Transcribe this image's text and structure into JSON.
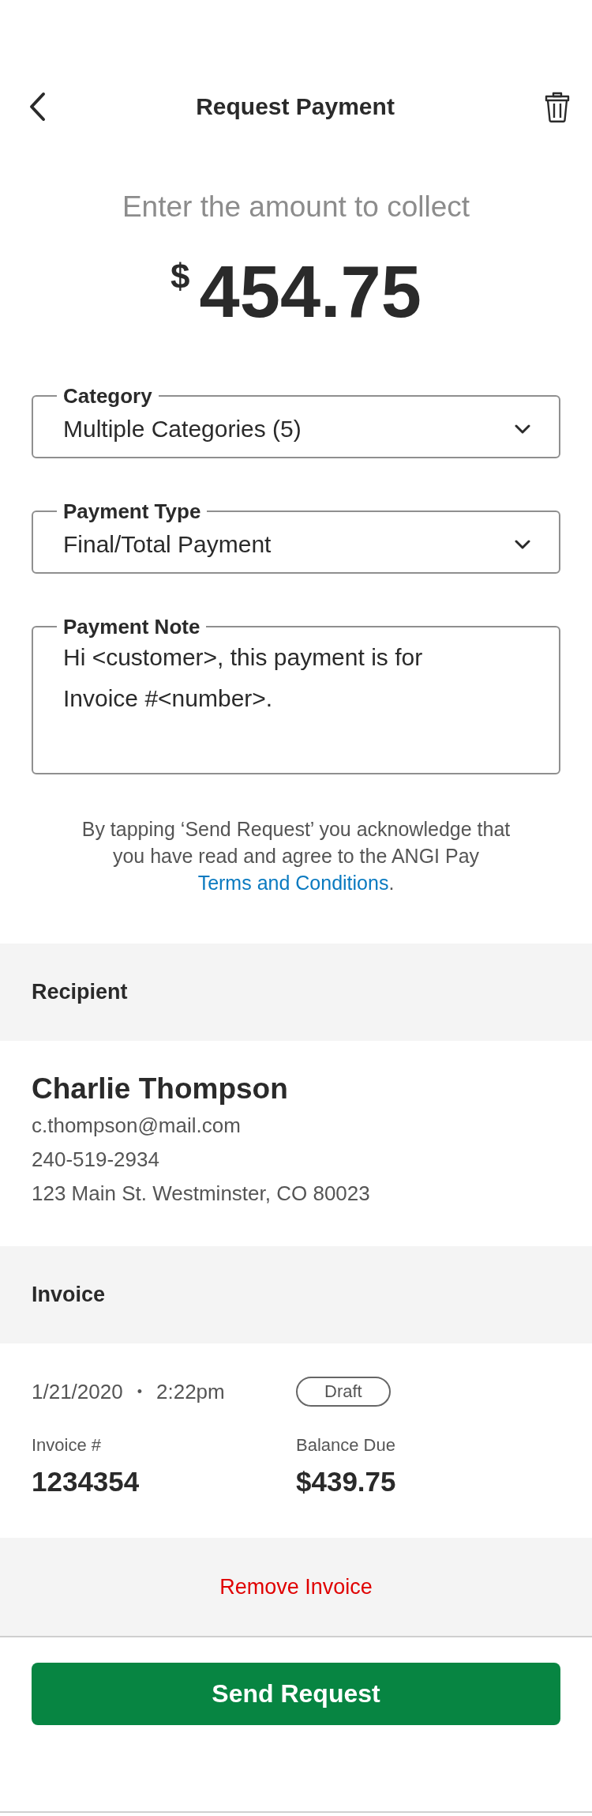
{
  "header": {
    "title": "Request Payment"
  },
  "amount": {
    "prompt": "Enter the amount to collect",
    "currency": "$",
    "value": "454.75"
  },
  "fields": [
    {
      "kind": "select",
      "label": "Category",
      "value": "Multiple Categories (5)"
    },
    {
      "kind": "select",
      "label": "Payment Type",
      "value": "Final/Total Payment"
    },
    {
      "kind": "textarea",
      "label": "Payment Note",
      "value": "Hi <customer>, this payment is for Invoice #<number>."
    }
  ],
  "legal": {
    "text": "By tapping ‘Send Request’ you acknowledge that you have read and agree to the ANGI Pay",
    "link": "Terms and Conditions",
    "after": "."
  },
  "recipient": {
    "heading": "Recipient",
    "name": "Charlie Thompson",
    "email": "c.thompson@mail.com",
    "phone": "240-519-2934",
    "address": "123 Main St. Westminster, CO 80023"
  },
  "invoice": {
    "heading": "Invoice",
    "date": "1/21/2020",
    "separator": "•",
    "time": "2:22pm",
    "status": "Draft",
    "columns": [
      {
        "label": "Invoice #",
        "value": "1234354"
      },
      {
        "label": "Balance Due",
        "value": "$439.75"
      }
    ],
    "remove": "Remove Invoice"
  },
  "primary_button": "Send Request"
}
